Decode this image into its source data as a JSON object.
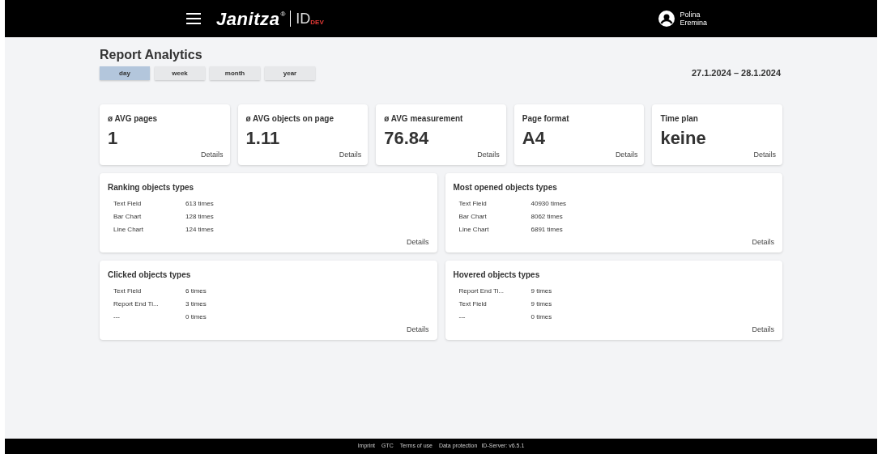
{
  "header": {
    "brand": "Janitza",
    "registered": "®",
    "product": "ID",
    "environment": "DEV",
    "user": {
      "first_name": "Polina",
      "last_name": "Eremina"
    }
  },
  "page": {
    "title": "Report Analytics",
    "date_range": "27.1.2024 – 28.1.2024"
  },
  "periods": [
    {
      "label": "day",
      "selected": true
    },
    {
      "label": "week",
      "selected": false
    },
    {
      "label": "month",
      "selected": false
    },
    {
      "label": "year",
      "selected": false
    }
  ],
  "stats": [
    {
      "title": "ø AVG pages",
      "value": "1",
      "link": "Details"
    },
    {
      "title": "ø AVG objects on page",
      "value": "1.11",
      "link": "Details"
    },
    {
      "title": "ø AVG measurement",
      "value": "76.84",
      "link": "Details"
    },
    {
      "title": "Page format",
      "value": "A4",
      "link": "Details"
    },
    {
      "title": "Time plan",
      "value": "keine",
      "link": "Details"
    }
  ],
  "lists": [
    {
      "title": "Ranking objects types",
      "link": "Details",
      "rows": [
        {
          "name": "Text Field",
          "count": "613 times"
        },
        {
          "name": "Bar Chart",
          "count": "128 times"
        },
        {
          "name": "Line Chart",
          "count": "124 times"
        }
      ]
    },
    {
      "title": "Most opened objects types",
      "link": "Details",
      "rows": [
        {
          "name": "Text Field",
          "count": "40930 times"
        },
        {
          "name": "Bar Chart",
          "count": "8062 times"
        },
        {
          "name": "Line Chart",
          "count": "6891 times"
        }
      ]
    },
    {
      "title": "Clicked objects types",
      "link": "Details",
      "rows": [
        {
          "name": "Text Field",
          "count": "6 times"
        },
        {
          "name": "Report End Ti...",
          "count": "3 times"
        },
        {
          "name": "---",
          "count": "0 times"
        }
      ]
    },
    {
      "title": "Hovered objects types",
      "link": "Details",
      "rows": [
        {
          "name": "Report End Ti...",
          "count": "9 times"
        },
        {
          "name": "Text Field",
          "count": "9 times"
        },
        {
          "name": "---",
          "count": "0 times"
        }
      ]
    }
  ],
  "footer": {
    "links": [
      "Imprint",
      "GTC",
      "Terms of use",
      "Data protection"
    ],
    "version": "ID-Server: v6.5.1"
  }
}
